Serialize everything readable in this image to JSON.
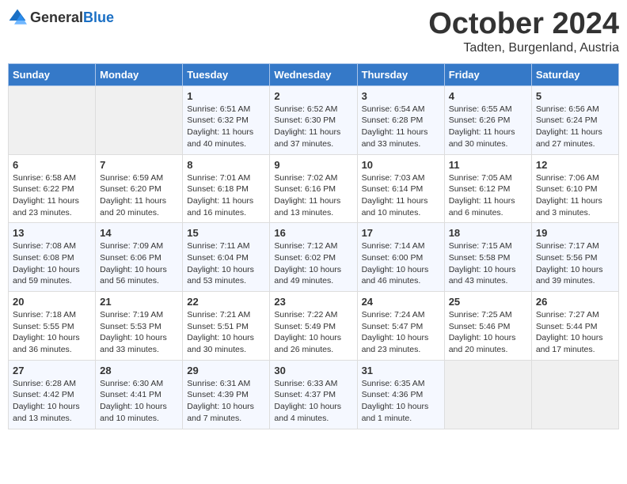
{
  "header": {
    "logo_general": "General",
    "logo_blue": "Blue",
    "month": "October 2024",
    "location": "Tadten, Burgenland, Austria"
  },
  "days_of_week": [
    "Sunday",
    "Monday",
    "Tuesday",
    "Wednesday",
    "Thursday",
    "Friday",
    "Saturday"
  ],
  "weeks": [
    [
      {
        "day": "",
        "empty": true
      },
      {
        "day": "",
        "empty": true
      },
      {
        "day": "1",
        "sunrise": "Sunrise: 6:51 AM",
        "sunset": "Sunset: 6:32 PM",
        "daylight": "Daylight: 11 hours and 40 minutes."
      },
      {
        "day": "2",
        "sunrise": "Sunrise: 6:52 AM",
        "sunset": "Sunset: 6:30 PM",
        "daylight": "Daylight: 11 hours and 37 minutes."
      },
      {
        "day": "3",
        "sunrise": "Sunrise: 6:54 AM",
        "sunset": "Sunset: 6:28 PM",
        "daylight": "Daylight: 11 hours and 33 minutes."
      },
      {
        "day": "4",
        "sunrise": "Sunrise: 6:55 AM",
        "sunset": "Sunset: 6:26 PM",
        "daylight": "Daylight: 11 hours and 30 minutes."
      },
      {
        "day": "5",
        "sunrise": "Sunrise: 6:56 AM",
        "sunset": "Sunset: 6:24 PM",
        "daylight": "Daylight: 11 hours and 27 minutes."
      }
    ],
    [
      {
        "day": "6",
        "sunrise": "Sunrise: 6:58 AM",
        "sunset": "Sunset: 6:22 PM",
        "daylight": "Daylight: 11 hours and 23 minutes."
      },
      {
        "day": "7",
        "sunrise": "Sunrise: 6:59 AM",
        "sunset": "Sunset: 6:20 PM",
        "daylight": "Daylight: 11 hours and 20 minutes."
      },
      {
        "day": "8",
        "sunrise": "Sunrise: 7:01 AM",
        "sunset": "Sunset: 6:18 PM",
        "daylight": "Daylight: 11 hours and 16 minutes."
      },
      {
        "day": "9",
        "sunrise": "Sunrise: 7:02 AM",
        "sunset": "Sunset: 6:16 PM",
        "daylight": "Daylight: 11 hours and 13 minutes."
      },
      {
        "day": "10",
        "sunrise": "Sunrise: 7:03 AM",
        "sunset": "Sunset: 6:14 PM",
        "daylight": "Daylight: 11 hours and 10 minutes."
      },
      {
        "day": "11",
        "sunrise": "Sunrise: 7:05 AM",
        "sunset": "Sunset: 6:12 PM",
        "daylight": "Daylight: 11 hours and 6 minutes."
      },
      {
        "day": "12",
        "sunrise": "Sunrise: 7:06 AM",
        "sunset": "Sunset: 6:10 PM",
        "daylight": "Daylight: 11 hours and 3 minutes."
      }
    ],
    [
      {
        "day": "13",
        "sunrise": "Sunrise: 7:08 AM",
        "sunset": "Sunset: 6:08 PM",
        "daylight": "Daylight: 10 hours and 59 minutes."
      },
      {
        "day": "14",
        "sunrise": "Sunrise: 7:09 AM",
        "sunset": "Sunset: 6:06 PM",
        "daylight": "Daylight: 10 hours and 56 minutes."
      },
      {
        "day": "15",
        "sunrise": "Sunrise: 7:11 AM",
        "sunset": "Sunset: 6:04 PM",
        "daylight": "Daylight: 10 hours and 53 minutes."
      },
      {
        "day": "16",
        "sunrise": "Sunrise: 7:12 AM",
        "sunset": "Sunset: 6:02 PM",
        "daylight": "Daylight: 10 hours and 49 minutes."
      },
      {
        "day": "17",
        "sunrise": "Sunrise: 7:14 AM",
        "sunset": "Sunset: 6:00 PM",
        "daylight": "Daylight: 10 hours and 46 minutes."
      },
      {
        "day": "18",
        "sunrise": "Sunrise: 7:15 AM",
        "sunset": "Sunset: 5:58 PM",
        "daylight": "Daylight: 10 hours and 43 minutes."
      },
      {
        "day": "19",
        "sunrise": "Sunrise: 7:17 AM",
        "sunset": "Sunset: 5:56 PM",
        "daylight": "Daylight: 10 hours and 39 minutes."
      }
    ],
    [
      {
        "day": "20",
        "sunrise": "Sunrise: 7:18 AM",
        "sunset": "Sunset: 5:55 PM",
        "daylight": "Daylight: 10 hours and 36 minutes."
      },
      {
        "day": "21",
        "sunrise": "Sunrise: 7:19 AM",
        "sunset": "Sunset: 5:53 PM",
        "daylight": "Daylight: 10 hours and 33 minutes."
      },
      {
        "day": "22",
        "sunrise": "Sunrise: 7:21 AM",
        "sunset": "Sunset: 5:51 PM",
        "daylight": "Daylight: 10 hours and 30 minutes."
      },
      {
        "day": "23",
        "sunrise": "Sunrise: 7:22 AM",
        "sunset": "Sunset: 5:49 PM",
        "daylight": "Daylight: 10 hours and 26 minutes."
      },
      {
        "day": "24",
        "sunrise": "Sunrise: 7:24 AM",
        "sunset": "Sunset: 5:47 PM",
        "daylight": "Daylight: 10 hours and 23 minutes."
      },
      {
        "day": "25",
        "sunrise": "Sunrise: 7:25 AM",
        "sunset": "Sunset: 5:46 PM",
        "daylight": "Daylight: 10 hours and 20 minutes."
      },
      {
        "day": "26",
        "sunrise": "Sunrise: 7:27 AM",
        "sunset": "Sunset: 5:44 PM",
        "daylight": "Daylight: 10 hours and 17 minutes."
      }
    ],
    [
      {
        "day": "27",
        "sunrise": "Sunrise: 6:28 AM",
        "sunset": "Sunset: 4:42 PM",
        "daylight": "Daylight: 10 hours and 13 minutes."
      },
      {
        "day": "28",
        "sunrise": "Sunrise: 6:30 AM",
        "sunset": "Sunset: 4:41 PM",
        "daylight": "Daylight: 10 hours and 10 minutes."
      },
      {
        "day": "29",
        "sunrise": "Sunrise: 6:31 AM",
        "sunset": "Sunset: 4:39 PM",
        "daylight": "Daylight: 10 hours and 7 minutes."
      },
      {
        "day": "30",
        "sunrise": "Sunrise: 6:33 AM",
        "sunset": "Sunset: 4:37 PM",
        "daylight": "Daylight: 10 hours and 4 minutes."
      },
      {
        "day": "31",
        "sunrise": "Sunrise: 6:35 AM",
        "sunset": "Sunset: 4:36 PM",
        "daylight": "Daylight: 10 hours and 1 minute."
      },
      {
        "day": "",
        "empty": true
      },
      {
        "day": "",
        "empty": true
      }
    ]
  ]
}
